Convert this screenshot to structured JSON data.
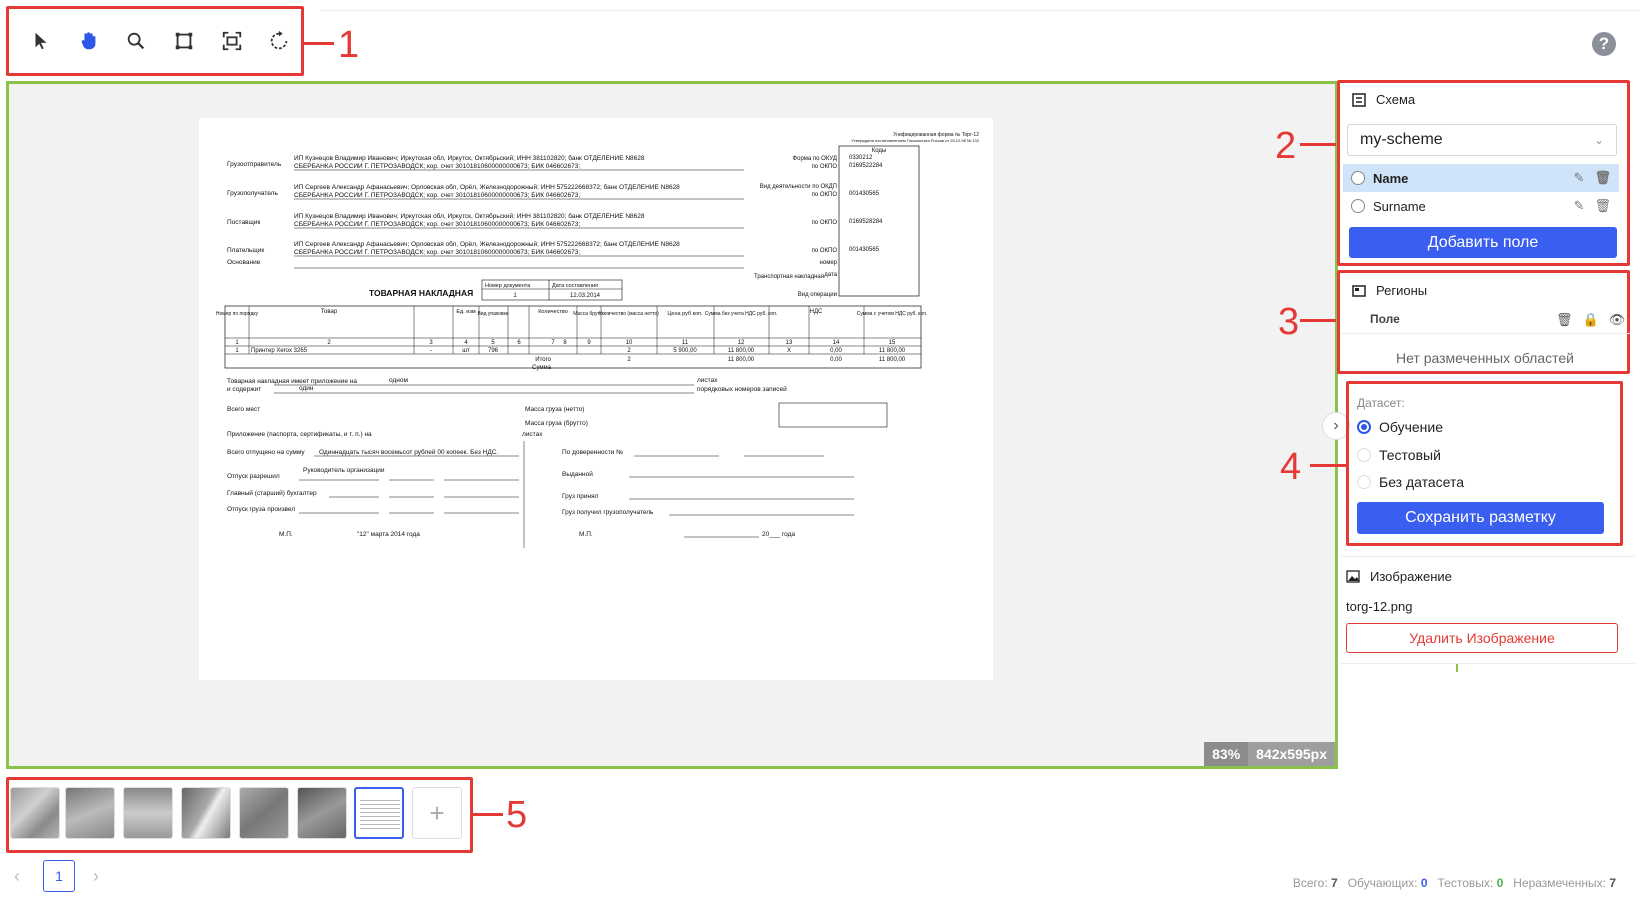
{
  "toolbar": {
    "tools": [
      "select-arrow-icon",
      "hand-pan-icon",
      "zoom-icon",
      "crop-box-icon",
      "fit-screen-icon",
      "rotate-icon"
    ]
  },
  "callouts": [
    "1",
    "2",
    "3",
    "4",
    "5"
  ],
  "help": "?",
  "canvas": {
    "zoom": "83%",
    "size": "842x595px"
  },
  "document": {
    "header_right": "Унифицированная форма № Торг-12",
    "header_right2": "Утверждена постановлением Госкомстата России от 25.12.98 № 132",
    "consignor_label": "Грузоотправитель",
    "consignor": "ИП Кузнецов Владимир Иванович; Иркутская обл, Иркутск, Октябрьский; ИНН 381102820; банк ОТДЕЛЕНИЕ N8628",
    "consignor2": "СБЕРБАНКА РОССИИ Г. ПЕТРОЗАВОДСК; кор. счет 30101810600000000673; БИК 046602673;",
    "consignee_label": "Грузополучатель",
    "consignee": "ИП Сергеев Александр Афанасьевич; Орловская обл, Орёл, Железнодорожный; ИНН 575222668372; банк ОТДЕЛЕНИЕ N8628",
    "consignee2": "СБЕРБАНКА РОССИИ Г. ПЕТРОЗАВОДСК; кор. счет 30101810600000000673; БИК 046602673;",
    "supplier_label": "Поставщик",
    "supplier": "ИП Кузнецов Владимир Иванович; Иркутская обл, Иркутск, Октябрьский; ИНН 381102820; банк ОТДЕЛЕНИЕ N8628",
    "supplier2": "СБЕРБАНКА РОССИИ Г. ПЕТРОЗАВОДСК; кор. счет 30101810600000000673; БИК 046602673;",
    "payer_label": "Плательщик",
    "payer": "ИП Сергеев Александр Афанасьевич; Орловская обл, Орёл, Железнодорожный; ИНН 575222668372; банк ОТДЕЛЕНИЕ N8628",
    "payer2": "СБЕРБАНКА РОССИИ Г. ПЕТРОЗАВОДСК; кор. счет 30101810600000000673; БИК 046602673;",
    "basis_label": "Основание",
    "codes": "Коды",
    "okud_label": "Форма по ОКУД",
    "okud": "0330212",
    "okpo_label": "по ОКПО",
    "okpo1": "0169522284",
    "activity_label": "Вид деятельности по ОКДП",
    "okpo2": "001430565",
    "okpo3": "0169528284",
    "okpo4": "001430565",
    "title": "ТОВАРНАЯ НАКЛАДНАЯ",
    "doc_num_label": "Номер документа",
    "doc_date_label": "Дата составления",
    "doc_num": "1",
    "doc_date": "12.03.2014",
    "transport_label": "Транспортная накладная",
    "number_label": "номер",
    "date_label": "дата",
    "op_label": "Вид операции",
    "table_headers": [
      "Номер по порядку",
      "Товар",
      "Ед. изм",
      "Вид упаковки",
      "Количество",
      "Масса брутто",
      "Количество (масса нетто)",
      "Цена руб коп.",
      "Сумма без учета НДС руб. коп.",
      "НДС",
      "Сумма с учетом НДС руб. коп."
    ],
    "table_nums": [
      "1",
      "2",
      "3",
      "4",
      "5",
      "6",
      "7",
      "8",
      "9",
      "10",
      "11",
      "12",
      "13",
      "14",
      "15"
    ],
    "row": [
      "1",
      "Принтер Xerox 3265",
      "-",
      "шт",
      "796",
      "-",
      "-",
      "-",
      "-",
      "2",
      "5 900,00",
      "11 800,00",
      "X",
      "0,00",
      "11 800,00"
    ],
    "total_label": "Итого",
    "sum_label": "Сумма",
    "total_qty": "2",
    "total_sum": "11 800,00",
    "total_vat": "0,00",
    "total_all": "11 800,00",
    "attachment": "Товарная накладная имеет приложение на",
    "attachment_val": "одном",
    "contains": "и содержит",
    "contains_val": "один",
    "sheets": "листах",
    "records": "порядковых номеров записей",
    "places": "Всего мест",
    "net_mass": "Масса груза (нетто)",
    "gross_mass": "Масса груза (брутто)",
    "appendix": "Приложение (паспорта, сертификаты, и т. п.) на",
    "shipped_sum": "Всего отпущено на сумму",
    "shipped_sum_val": "Одиннадцать тысяч восемьсот рублей 00 копеек. Без НДС.",
    "release_allowed": "Отпуск разрешил",
    "head": "Руководитель организации",
    "chief_acc": "Главный (старший) бухгалтер",
    "release_done": "Отпуск груза произвел",
    "mp": "М.П.",
    "date_sig": "\"12\" марта 2014 года",
    "proxy": "По доверенности №",
    "issued": "Выданной",
    "cargo_accepted": "Груз принял",
    "cargo_received": "Груз получил грузополучатель",
    "year": "20___ года"
  },
  "schema": {
    "title": "Схема",
    "selected": "my-scheme",
    "fields": [
      {
        "label": "Name",
        "active": true
      },
      {
        "label": "Surname",
        "active": false
      }
    ],
    "add_button": "Добавить поле"
  },
  "regions": {
    "title": "Регионы",
    "column_label": "Поле",
    "empty": "Нет размеченных областей"
  },
  "dataset": {
    "label": "Датасет:",
    "options": [
      "Обучение",
      "Тестовый",
      "Без датасета"
    ],
    "selected_index": 0,
    "save_button": "Сохранить разметку"
  },
  "image": {
    "title": "Изображение",
    "filename": "torg-12.png",
    "delete_button": "Удалить Изображение"
  },
  "thumbnails": {
    "count": 7,
    "selected_index": 6,
    "add": "+"
  },
  "pagination": {
    "prev": "‹",
    "current": "1",
    "next": "›"
  },
  "stats": {
    "total_label": "Всего:",
    "total": "7",
    "train_label": "Обучающих:",
    "train": "0",
    "test_label": "Тестовых:",
    "test": "0",
    "unlabeled_label": "Неразмеченных:",
    "unlabeled": "7"
  },
  "colors": {
    "accent": "#3a5ef0",
    "callout": "#e53935",
    "canvas_border": "#8bc34a",
    "train": "#3a5ef0",
    "test": "#4caf50"
  }
}
